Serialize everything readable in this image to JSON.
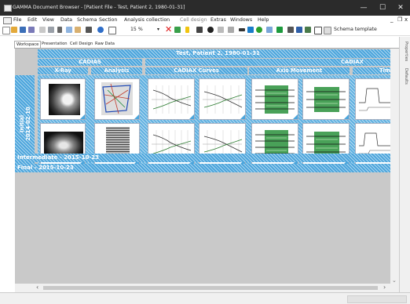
{
  "window": {
    "title": "GAMMA Document Browser - [Patient File - Test, Patient 2, 1980-01-31]",
    "minimize": "—",
    "maximize": "☐",
    "close": "✕"
  },
  "menu": {
    "items": [
      "File",
      "Edit",
      "View",
      "Data",
      "Schema",
      "Section",
      "Analysis collection",
      "Cell design",
      "Extras",
      "Windows",
      "Help"
    ],
    "disabled_index": 7,
    "mdi_minimize": "_",
    "mdi_restore": "❐",
    "mdi_close": "x"
  },
  "toolbar": {
    "zoom": "15 %",
    "schema_template_label": "Schema template"
  },
  "tabs": [
    "Workspace",
    "Presentation",
    "Cell Design",
    "Raw Data"
  ],
  "side_tabs": [
    "Properties",
    "Defaults"
  ],
  "patient_header": "Test, Patient 2, 1980-01-31",
  "groups": [
    "CADIAS",
    "CADIAX"
  ],
  "columns": [
    "X-Ray",
    "Analysis",
    "CADIAX Curves",
    "Axis Movement",
    "Time"
  ],
  "sessions": [
    {
      "label": "Initial\n2014-02-10"
    },
    {
      "label": "Intermediate - 2015-10-23"
    },
    {
      "label": "Final - 2015-10-23"
    }
  ],
  "scroll": {
    "left": "‹",
    "right": "›",
    "down": "⌄"
  },
  "colors": {
    "accent": "#4ba5dc",
    "titlebar": "#2b2b2b",
    "canvas": "#c9c9c9"
  }
}
